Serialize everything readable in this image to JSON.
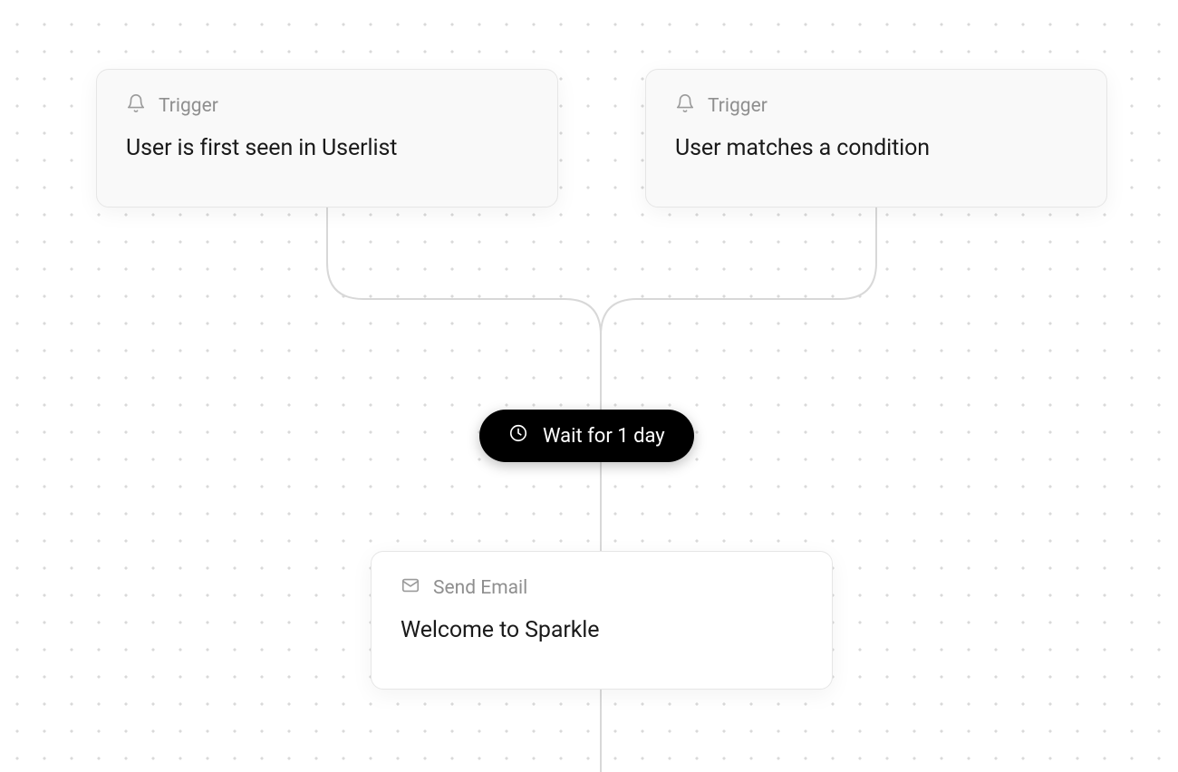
{
  "nodes": {
    "trigger1": {
      "type_label": "Trigger",
      "title": "User is first seen in Userlist"
    },
    "trigger2": {
      "type_label": "Trigger",
      "title": "User matches a condition"
    },
    "wait": {
      "label": "Wait for 1 day"
    },
    "email1": {
      "type_label": "Send Email",
      "title": "Welcome to Sparkle"
    }
  }
}
